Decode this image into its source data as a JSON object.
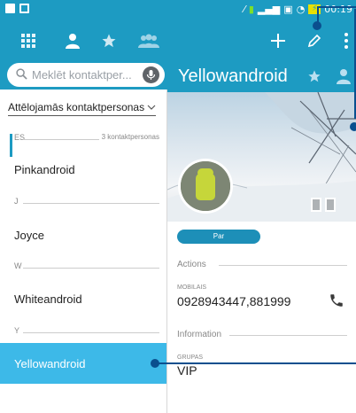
{
  "status_bar": {
    "time": "00:19"
  },
  "search": {
    "placeholder": "Meklēt kontaktper..."
  },
  "contacts_list": {
    "filter_label": "Attēlojamās kontaktpersonas",
    "sections": [
      {
        "letter": "ES",
        "count": "3 kontaktpersonas"
      },
      {
        "letter": "J"
      },
      {
        "letter": "W"
      },
      {
        "letter": "Y"
      }
    ],
    "contacts": [
      "Pinkandroid",
      "Joyce",
      "Whiteandroid",
      "Yellowandroid"
    ]
  },
  "detail": {
    "name": "Yellowandroid",
    "par_button": "Par",
    "actions_header": "Actions",
    "phone_label": "MOBILAIS",
    "phone_value": "0928943447,881999",
    "information_header": "Information",
    "group_label": "GRUPAS",
    "group_value": "VIP"
  },
  "colors": {
    "toolbar": "#1d9bc2",
    "selected_row": "#3db9e8",
    "callout": "#0a4f8e"
  },
  "icons": [
    "apps-grid-icon",
    "person-icon",
    "star-icon",
    "groups-icon",
    "add-icon",
    "edit-icon",
    "more-icon",
    "search-icon",
    "mic-icon",
    "favorite-star-icon",
    "contact-avatar-icon",
    "phone-icon"
  ]
}
